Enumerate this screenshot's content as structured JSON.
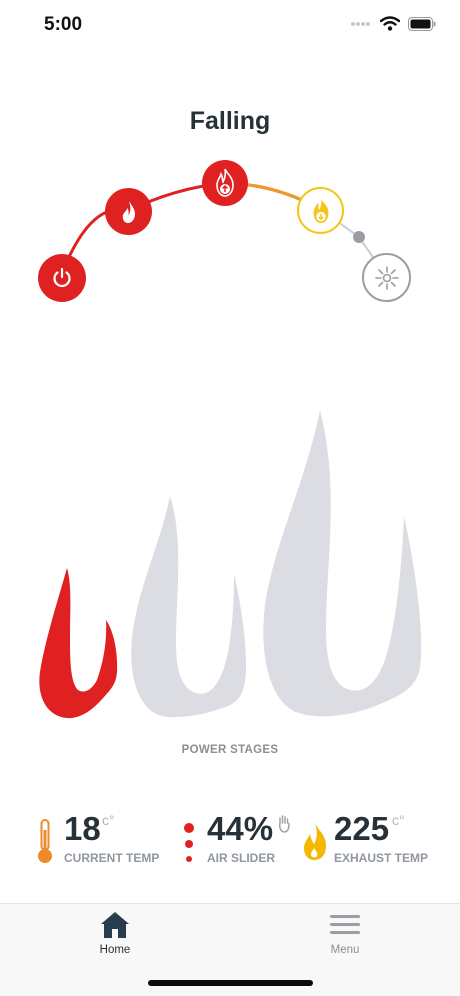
{
  "status_bar": {
    "time": "5:00"
  },
  "state": {
    "title": "Falling"
  },
  "stages": [
    {
      "name": "off",
      "icon": "power-icon"
    },
    {
      "name": "kindling",
      "icon": "flame-icon"
    },
    {
      "name": "increasing",
      "icon": "flame-up-icon"
    },
    {
      "name": "falling",
      "icon": "flame-down-icon"
    },
    {
      "name": "ember",
      "icon": "spark-icon"
    }
  ],
  "power_stages": {
    "label": "POWER STAGES",
    "active_stage": 1,
    "total": 3
  },
  "stats": {
    "current_temp": {
      "value": "18",
      "unit": "c°",
      "label": "CURRENT TEMP"
    },
    "air_slider": {
      "value": "44%",
      "label": "AIR SLIDER"
    },
    "exhaust_temp": {
      "value": "225",
      "unit": "c°",
      "label": "EXHAUST TEMP"
    }
  },
  "tabs": [
    {
      "label": "Home",
      "active": true
    },
    {
      "label": "Menu",
      "active": false
    }
  ],
  "colors": {
    "red": "#e02121",
    "orange": "#ee9a2c",
    "yellow": "#f5c518",
    "grey": "#9a9ea3",
    "flame_grey": "#dcdde2"
  }
}
